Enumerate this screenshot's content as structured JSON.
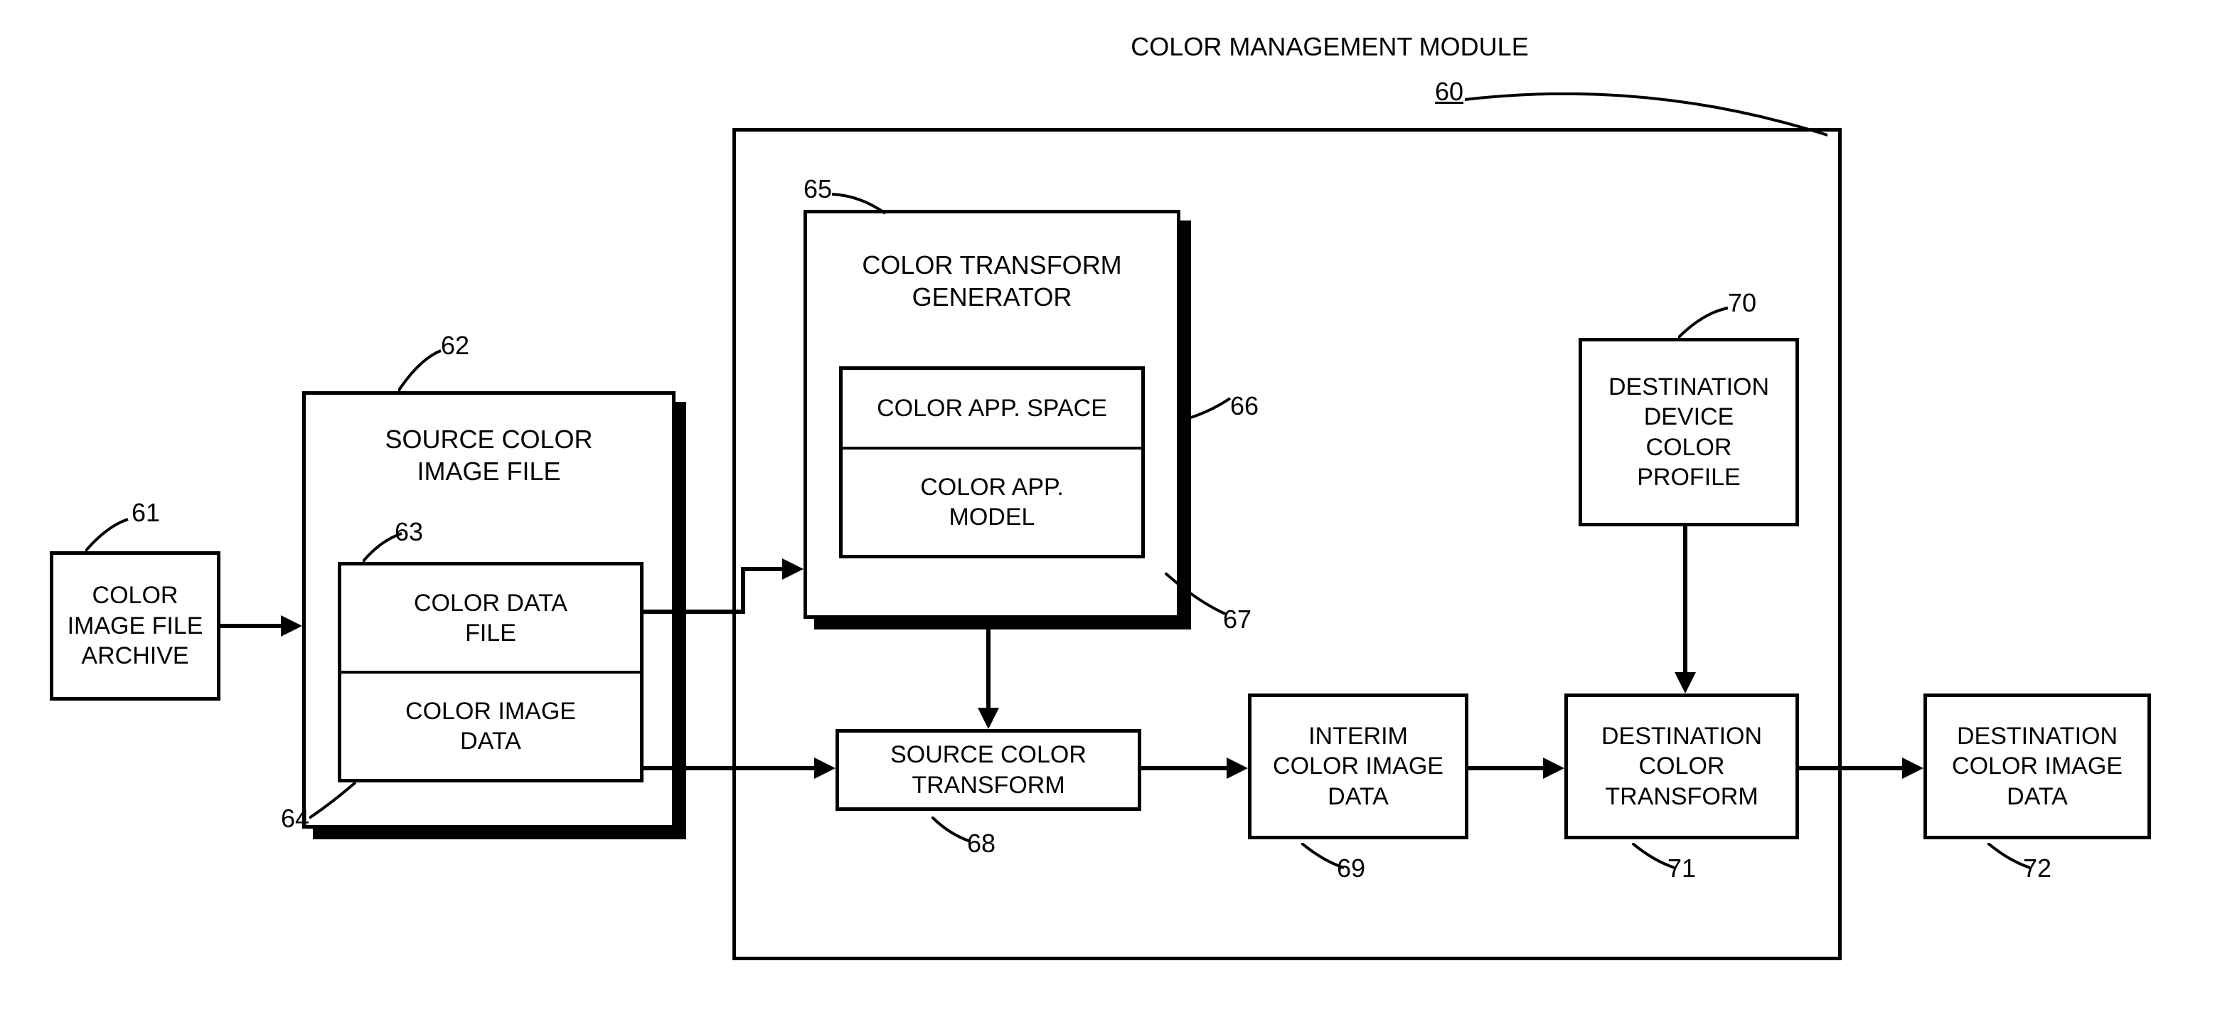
{
  "title": "COLOR MANAGEMENT MODULE",
  "module_ref": "60",
  "blocks": {
    "archive": {
      "label": "COLOR\nIMAGE FILE\nARCHIVE",
      "ref": "61"
    },
    "source_file": {
      "label": "SOURCE COLOR\nIMAGE FILE",
      "ref": "62",
      "color_data_file": {
        "label": "COLOR DATA\nFILE",
        "ref": "63"
      },
      "color_image_data": {
        "label": "COLOR IMAGE\nDATA",
        "ref": "64"
      }
    },
    "generator": {
      "label": "COLOR TRANSFORM\nGENERATOR",
      "ref": "65",
      "space": {
        "label": "COLOR APP. SPACE",
        "ref": "66"
      },
      "model": {
        "label": "COLOR APP.\nMODEL",
        "ref": "67"
      }
    },
    "source_transform": {
      "label": "SOURCE COLOR\nTRANSFORM",
      "ref": "68"
    },
    "interim": {
      "label": "INTERIM\nCOLOR IMAGE\nDATA",
      "ref": "69"
    },
    "dest_profile": {
      "label": "DESTINATION\nDEVICE\nCOLOR\nPROFILE",
      "ref": "70"
    },
    "dest_transform": {
      "label": "DESTINATION\nCOLOR\nTRANSFORM",
      "ref": "71"
    },
    "dest_image": {
      "label": "DESTINATION\nCOLOR IMAGE\nDATA",
      "ref": "72"
    }
  },
  "chart_data": {
    "type": "diagram",
    "nodes": [
      {
        "id": 61,
        "label": "COLOR IMAGE FILE ARCHIVE"
      },
      {
        "id": 62,
        "label": "SOURCE COLOR IMAGE FILE",
        "children": [
          63,
          64
        ]
      },
      {
        "id": 63,
        "label": "COLOR DATA FILE"
      },
      {
        "id": 64,
        "label": "COLOR IMAGE DATA"
      },
      {
        "id": 65,
        "label": "COLOR TRANSFORM GENERATOR",
        "children": [
          66,
          67
        ]
      },
      {
        "id": 66,
        "label": "COLOR APP. SPACE"
      },
      {
        "id": 67,
        "label": "COLOR APP. MODEL"
      },
      {
        "id": 68,
        "label": "SOURCE COLOR TRANSFORM"
      },
      {
        "id": 69,
        "label": "INTERIM COLOR IMAGE DATA"
      },
      {
        "id": 70,
        "label": "DESTINATION DEVICE COLOR PROFILE"
      },
      {
        "id": 71,
        "label": "DESTINATION COLOR TRANSFORM"
      },
      {
        "id": 72,
        "label": "DESTINATION COLOR IMAGE DATA"
      },
      {
        "id": 60,
        "label": "COLOR MANAGEMENT MODULE",
        "children": [
          65,
          68,
          69,
          70,
          71
        ]
      }
    ],
    "edges": [
      {
        "from": 61,
        "to": 62
      },
      {
        "from": 63,
        "to": 65
      },
      {
        "from": 64,
        "to": 68
      },
      {
        "from": 65,
        "to": 68
      },
      {
        "from": 68,
        "to": 69
      },
      {
        "from": 69,
        "to": 71
      },
      {
        "from": 70,
        "to": 71
      },
      {
        "from": 71,
        "to": 72
      }
    ]
  }
}
